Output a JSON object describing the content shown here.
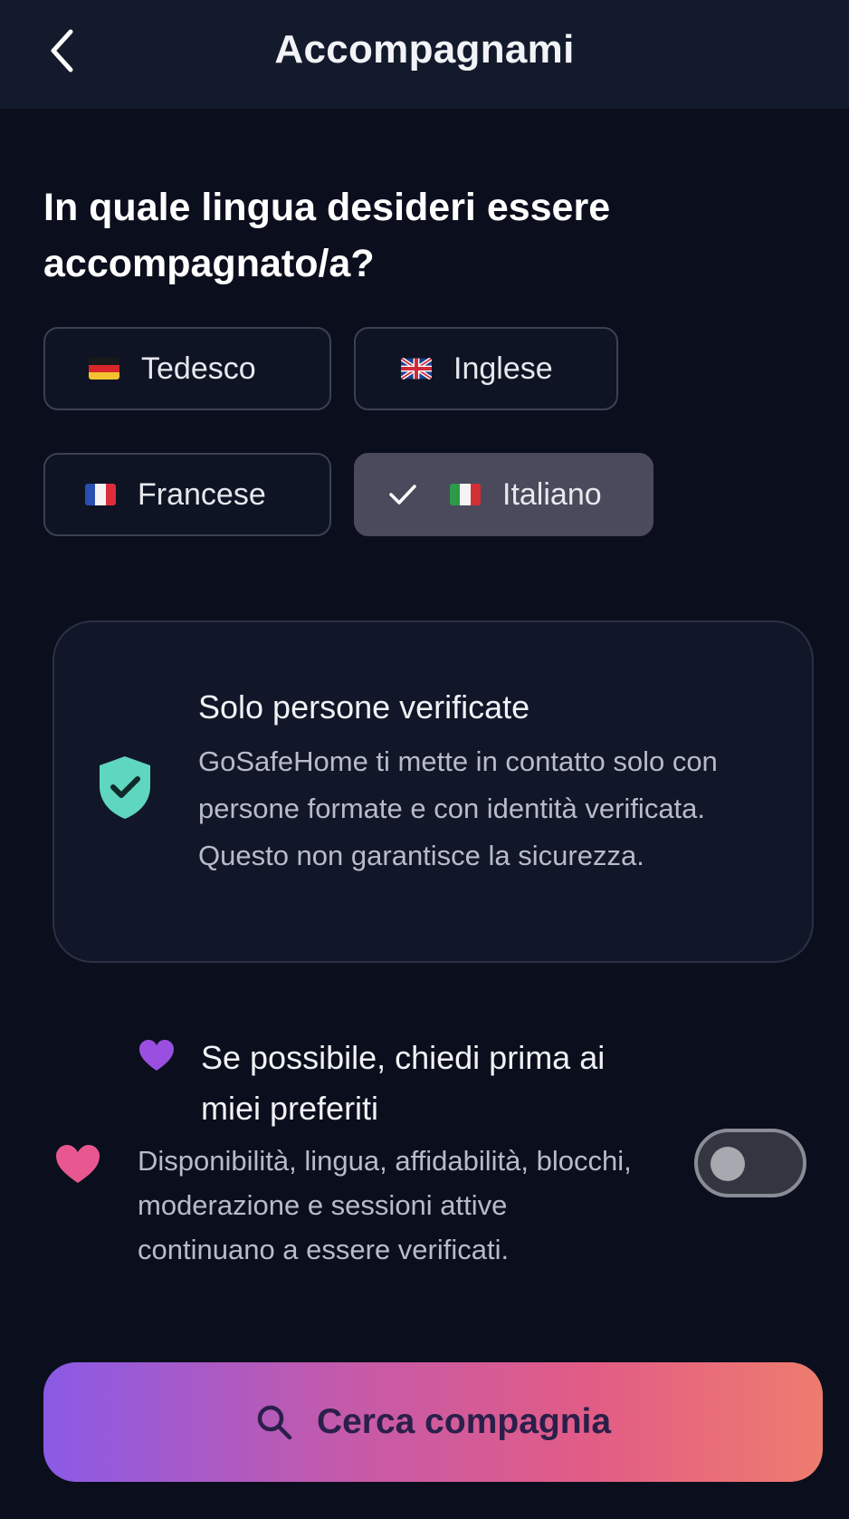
{
  "header": {
    "title": "Accompagnami"
  },
  "question": "In quale lingua desideri essere accompagnato/a?",
  "languages": [
    {
      "label": "Tedesco",
      "flag": "de-flag-icon",
      "selected": false
    },
    {
      "label": "Inglese",
      "flag": "uk-flag-icon",
      "selected": false
    },
    {
      "label": "Francese",
      "flag": "fr-flag-icon",
      "selected": false
    },
    {
      "label": "Italiano",
      "flag": "it-flag-icon",
      "selected": true
    }
  ],
  "info": {
    "title": "Solo persone verificate",
    "text": "GoSafeHome ti mette in contatto solo con persone formate e con identità verificata. Questo non garantisce la sicurezza."
  },
  "favorites": {
    "title": "Se possibile, chiedi prima ai miei preferiti",
    "text": "Disponibilità, lingua, affidabilità, blocchi, moderazione e sessioni attive continuano a essere verificati.",
    "toggle_on": false
  },
  "cta": {
    "label": "Cerca compagnia"
  },
  "colors": {
    "background": "#0b0f1d",
    "header": "#131a2c",
    "accent_shield": "#5fd6c0",
    "heart_pink": "#e8578f",
    "heart_purple": "#9b4fe0",
    "cta_gradient_start": "#8a5ae6",
    "cta_gradient_end": "#ee7c6e"
  }
}
